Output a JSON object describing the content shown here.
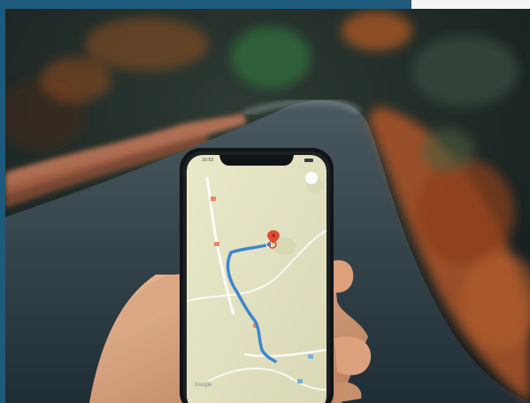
{
  "photo": {
    "subject": "hand-holding-phone-with-map",
    "phone": {
      "status_time": "16:52",
      "map_watermark": "Google"
    }
  }
}
